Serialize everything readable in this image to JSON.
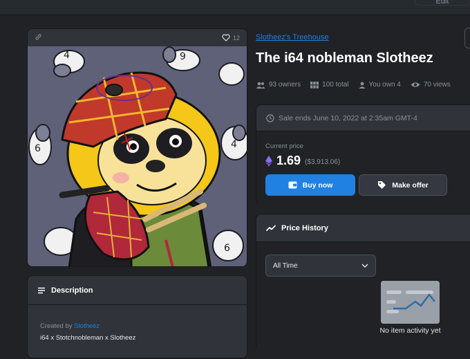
{
  "topbar": {
    "edit_label": "Edit"
  },
  "asset": {
    "favorites": "12",
    "collection": "Slotheez's Treehouse",
    "title": "The i64 nobleman Slotheez",
    "stats": {
      "owners": "93 owners",
      "total": "100 total",
      "you_own": "You own 4",
      "views": "70 views"
    }
  },
  "sale": {
    "ends": "Sale ends June 10, 2022 at 2:35am GMT-4",
    "current_price_label": "Current price",
    "price": "1.69",
    "fiat": "($3,913.06)",
    "buy_label": "Buy now",
    "offer_label": "Make offer"
  },
  "price_history": {
    "title": "Price History",
    "range": "All Time",
    "empty_text": "No item activity yet"
  },
  "description": {
    "title": "Description",
    "created_by_label": "Created by",
    "creator": "Slotheez",
    "text": "i64 x Stotchnobleman x Slotheez"
  },
  "colors": {
    "accent": "#2081e2",
    "card": "#303339",
    "background": "#202225"
  },
  "icons": [
    "link-icon",
    "heart-icon",
    "owners-icon",
    "grid-icon",
    "person-icon",
    "eye-icon",
    "clock-icon",
    "ethereum-icon",
    "wallet-icon",
    "tag-icon",
    "trend-icon",
    "chevron-down-icon",
    "list-icon"
  ]
}
